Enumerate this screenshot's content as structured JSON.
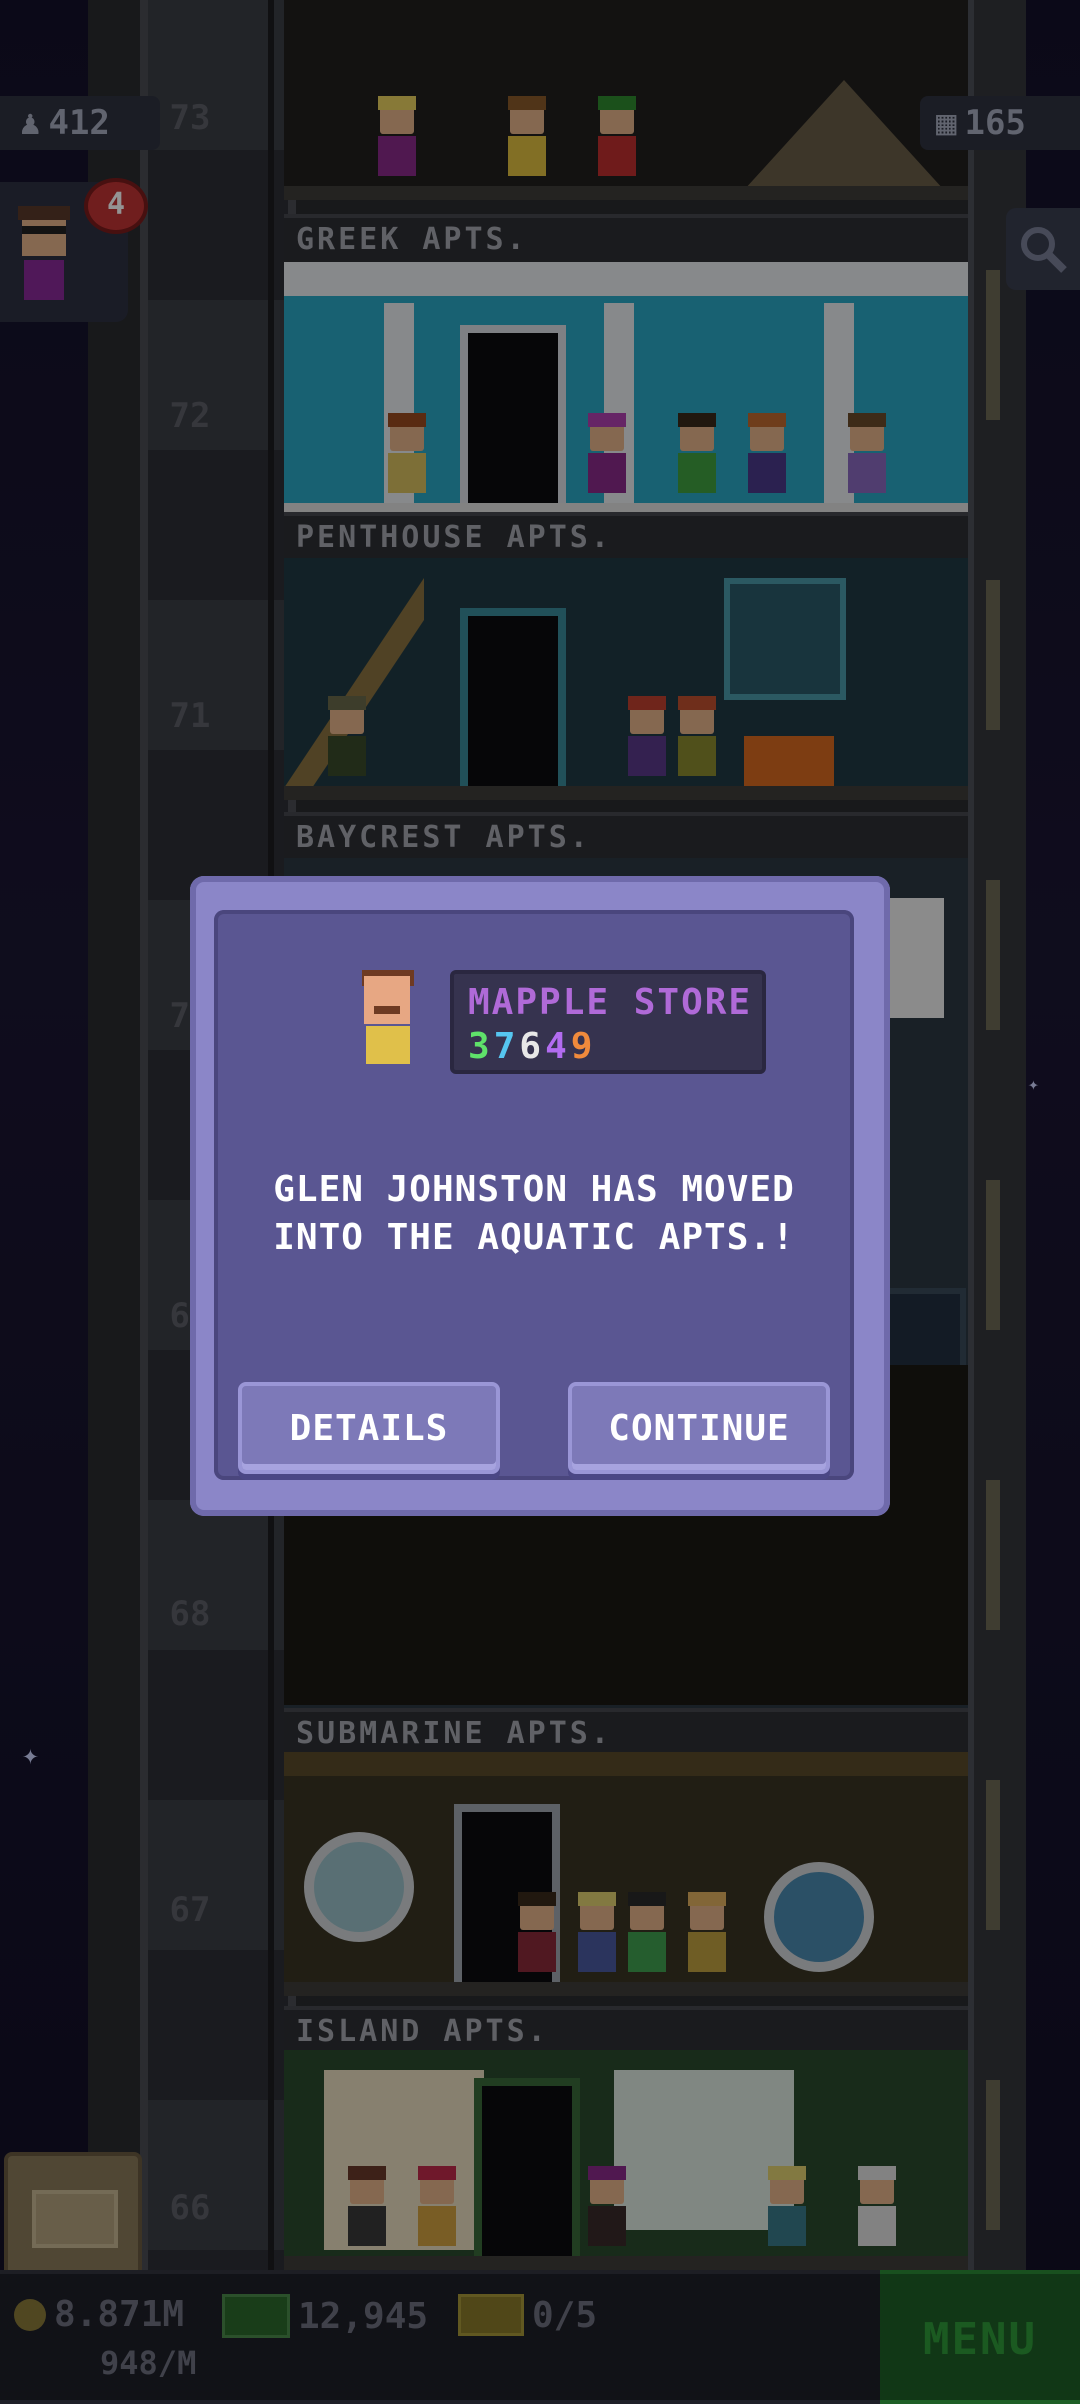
{
  "hud": {
    "residents_count": "412",
    "floors_count": "165",
    "notification_badge": "4"
  },
  "tower": {
    "floor_numbers": [
      "73",
      "72",
      "71",
      "70",
      "69",
      "68",
      "67",
      "66"
    ],
    "floor_labels": [
      "GREEK APTS.",
      "PENTHOUSE APTS.",
      "BAYCREST APTS.",
      "SUBMARINE APTS.",
      "ISLAND APTS."
    ]
  },
  "dialog": {
    "store_name": "MAPPLE STORE",
    "store_digits": [
      "3",
      "7",
      "6",
      "4",
      "9"
    ],
    "digit_colors": [
      "#5fe26a",
      "#56c6f0",
      "#e8e8e8",
      "#b26cf0",
      "#f08a3c"
    ],
    "message": "GLEN JOHNSTON HAS MOVED INTO THE AQUATIC APTS.!",
    "details_label": "DETAILS",
    "continue_label": "CONTINUE"
  },
  "bottom_bar": {
    "coins": "8.871M",
    "coins_rate": "948/M",
    "bux": "12,945",
    "tickets": "0/5",
    "menu_label": "MENU"
  },
  "colors": {
    "dialog_frame": "#8b86c8",
    "dialog_body": "#5a5692",
    "menu_green": "#1e5f26"
  }
}
